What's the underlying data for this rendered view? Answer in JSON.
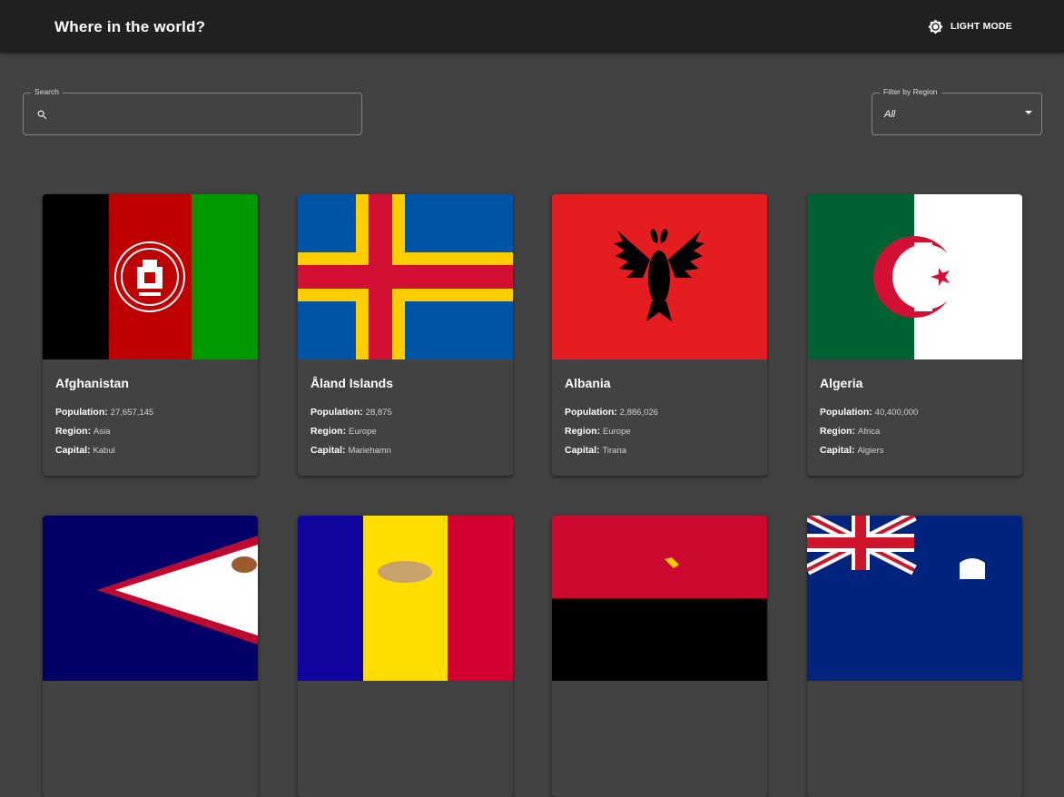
{
  "header": {
    "title": "Where in the world?",
    "mode_toggle_label": "LIGHT MODE"
  },
  "search": {
    "label": "Search",
    "value": "",
    "icon": "search-icon"
  },
  "filter": {
    "label": "Filter by Region",
    "selected": "All",
    "icon": "chevron-down-icon"
  },
  "labels": {
    "population": "Population:",
    "region": "Region:",
    "capital": "Capital:"
  },
  "countries": [
    {
      "name": "Afghanistan",
      "population": "27,657,145",
      "region": "Asia",
      "capital": "Kabul"
    },
    {
      "name": "Åland Islands",
      "population": "28,875",
      "region": "Europe",
      "capital": "Mariehamn"
    },
    {
      "name": "Albania",
      "population": "2,886,026",
      "region": "Europe",
      "capital": "Tirana"
    },
    {
      "name": "Algeria",
      "population": "40,400,000",
      "region": "Africa",
      "capital": "Algiers"
    }
  ],
  "colors": {
    "appbar": "#212121",
    "background": "#424242",
    "text": "#ffffff"
  }
}
